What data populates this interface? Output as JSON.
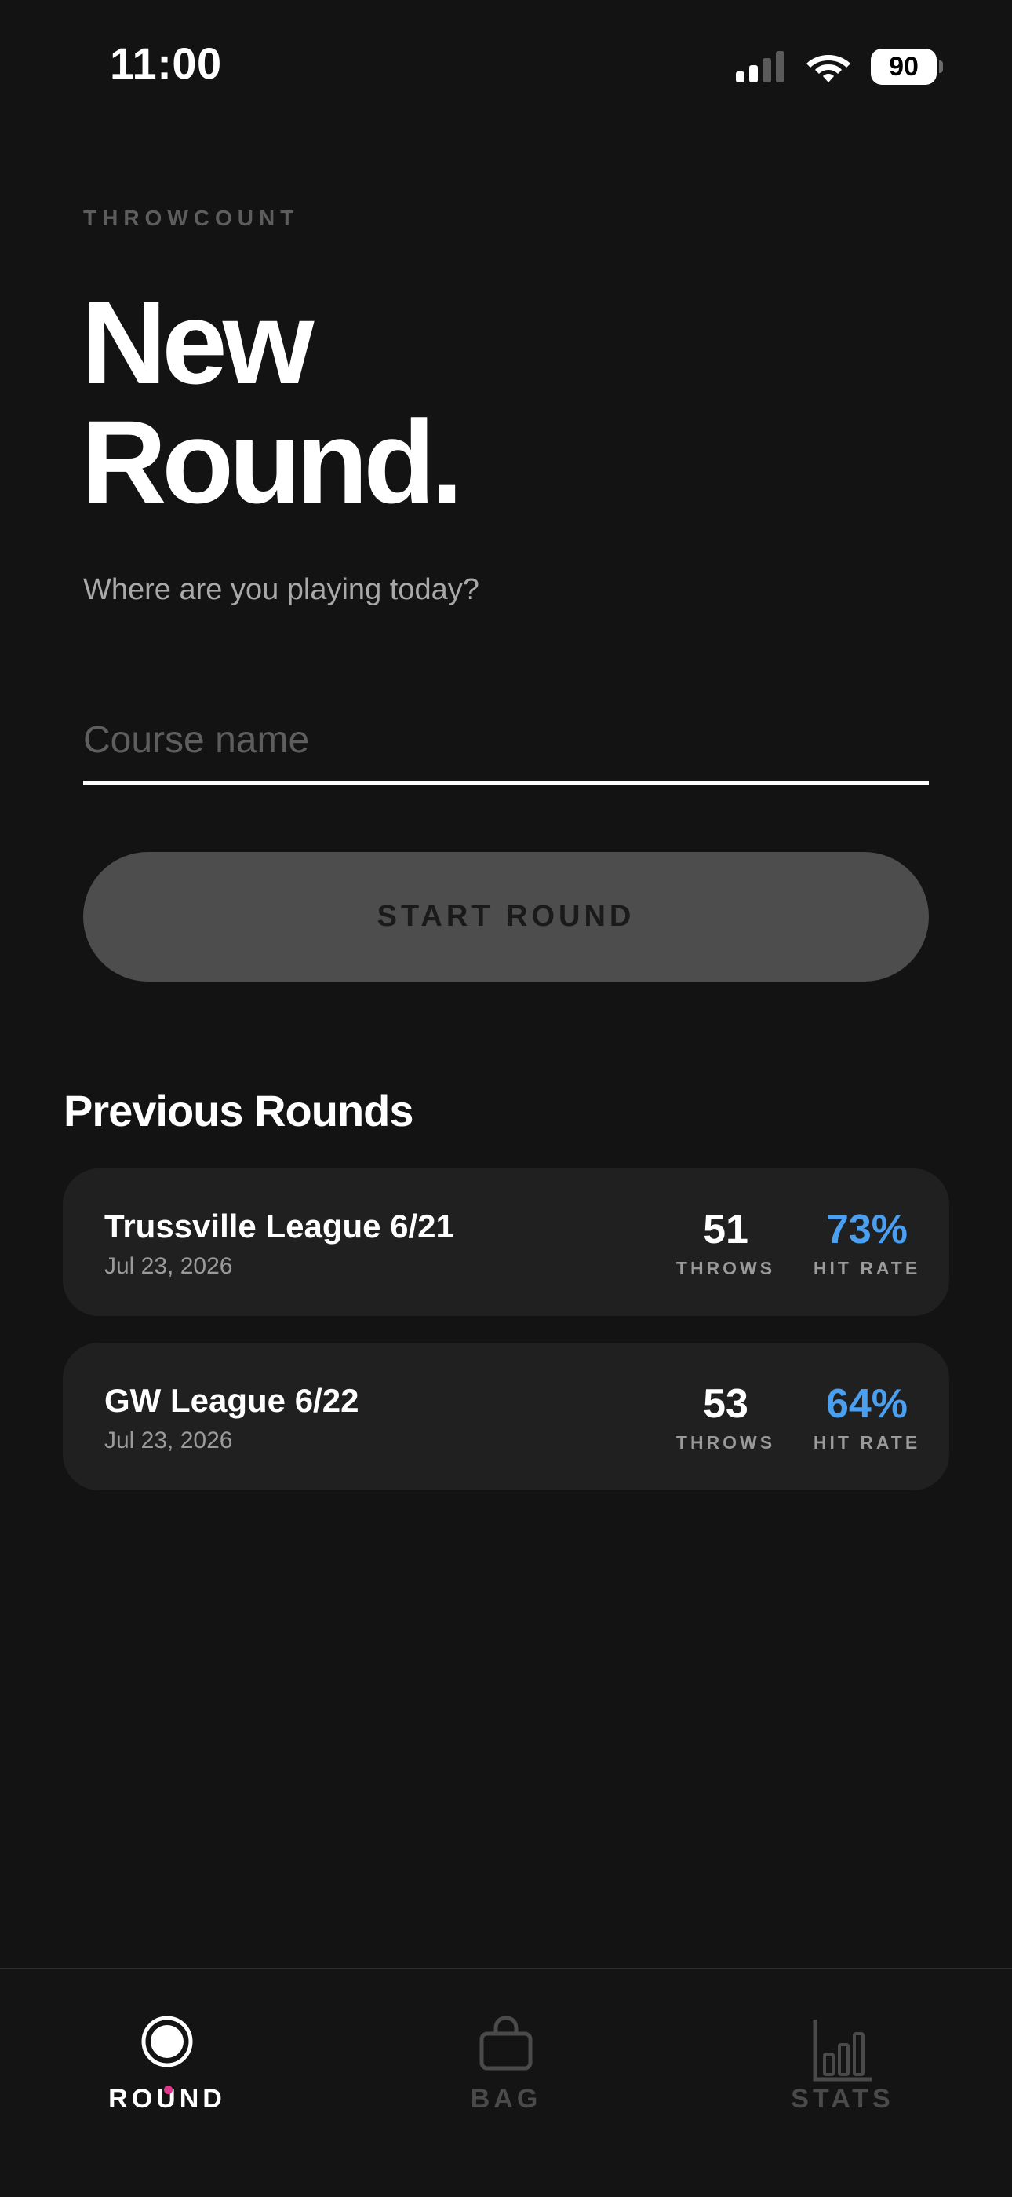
{
  "status_bar": {
    "time": "11:00",
    "battery": "90",
    "icons": [
      "signal-icon",
      "wifi-icon",
      "battery-icon"
    ]
  },
  "header": {
    "brand": "THROWCOUNT",
    "title": "New Round.",
    "subtitle": "Where are you playing today?"
  },
  "form": {
    "course_placeholder": "Course name",
    "course_value": "",
    "start_label": "START ROUND"
  },
  "previous_rounds": {
    "title": "Previous Rounds",
    "throws_label": "THROWS",
    "hit_rate_label": "HIT RATE",
    "items": [
      {
        "name": "Trussville League 6/21",
        "date": "Jul 23, 2026",
        "throws": "51",
        "hit_rate": "73%"
      },
      {
        "name": "GW League 6/22",
        "date": "Jul 23, 2026",
        "throws": "53",
        "hit_rate": "64%"
      }
    ]
  },
  "tab_bar": {
    "active": "ROUND",
    "tabs": [
      {
        "label": "ROUND",
        "icon": "target-icon"
      },
      {
        "label": "BAG",
        "icon": "bag-icon"
      },
      {
        "label": "STATS",
        "icon": "bar-chart-icon"
      }
    ]
  },
  "colors": {
    "background": "#131313",
    "card": "#202020",
    "accent_blue": "#4a9ff0",
    "active_dot": "#e0378c",
    "button": "#4d4d4d"
  }
}
